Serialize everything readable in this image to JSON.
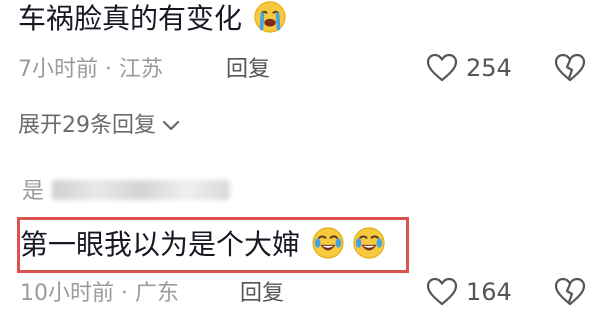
{
  "comment1": {
    "text": "车祸脸真的有变化",
    "emoji": "loudly-crying-face",
    "time_location": "7小时前 · 江苏",
    "reply_label": "回复",
    "likes": "254",
    "expand_label": "展开29条回复"
  },
  "reply1": {
    "username": "是",
    "text": "第一眼我以为是个大婶",
    "emojis": [
      "tears-of-joy-face",
      "tears-of-joy-face"
    ],
    "time_location": "10小时前 · 广东",
    "reply_label": "回复",
    "likes": "164"
  },
  "colors": {
    "text": "#161823",
    "meta": "#9b9b9b",
    "highlight": "#d9534f"
  }
}
